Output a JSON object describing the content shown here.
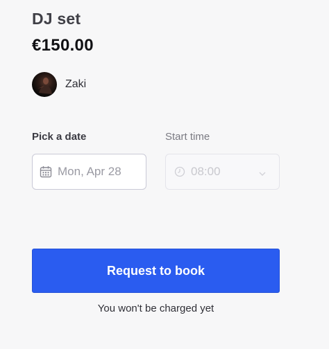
{
  "listing": {
    "title": "DJ set",
    "price": "€150.00"
  },
  "host": {
    "name": "Zaki",
    "avatar_icon": "profile-photo"
  },
  "date_picker": {
    "label": "Pick a date",
    "value": "Mon, Apr 28",
    "icon": "calendar-icon"
  },
  "time_picker": {
    "label": "Start time",
    "value": "08:00",
    "icon": "clock-icon",
    "state": "disabled"
  },
  "cta": {
    "label": "Request to book",
    "color": "#2a5cf0"
  },
  "note": "You won't be charged yet"
}
